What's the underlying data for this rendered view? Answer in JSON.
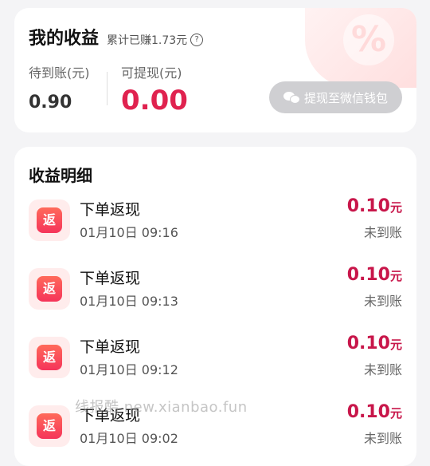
{
  "earnings": {
    "title": "我的收益",
    "total_earned": "累计已赚1.73元",
    "help_glyph": "?",
    "pending_label": "待到账(元)",
    "pending_value": "0.90",
    "available_label": "可提现(元)",
    "available_value": "0.00",
    "withdraw_button": "提现至微信钱包"
  },
  "details": {
    "title": "收益明细",
    "icon_text": "返",
    "items": [
      {
        "name": "下单返现",
        "time": "01月10日 09:16",
        "amount": "0.10",
        "unit": "元",
        "status": "未到账"
      },
      {
        "name": "下单返现",
        "time": "01月10日 09:13",
        "amount": "0.10",
        "unit": "元",
        "status": "未到账"
      },
      {
        "name": "下单返现",
        "time": "01月10日 09:12",
        "amount": "0.10",
        "unit": "元",
        "status": "未到账"
      },
      {
        "name": "下单返现",
        "time": "01月10日 09:02",
        "amount": "0.10",
        "unit": "元",
        "status": "未到账"
      }
    ]
  },
  "watermark": "线报酷 new.xianbao.fun",
  "colors": {
    "accent": "#e0224f",
    "amount": "#c8164a",
    "button_disabled": "#cfcfd2"
  }
}
